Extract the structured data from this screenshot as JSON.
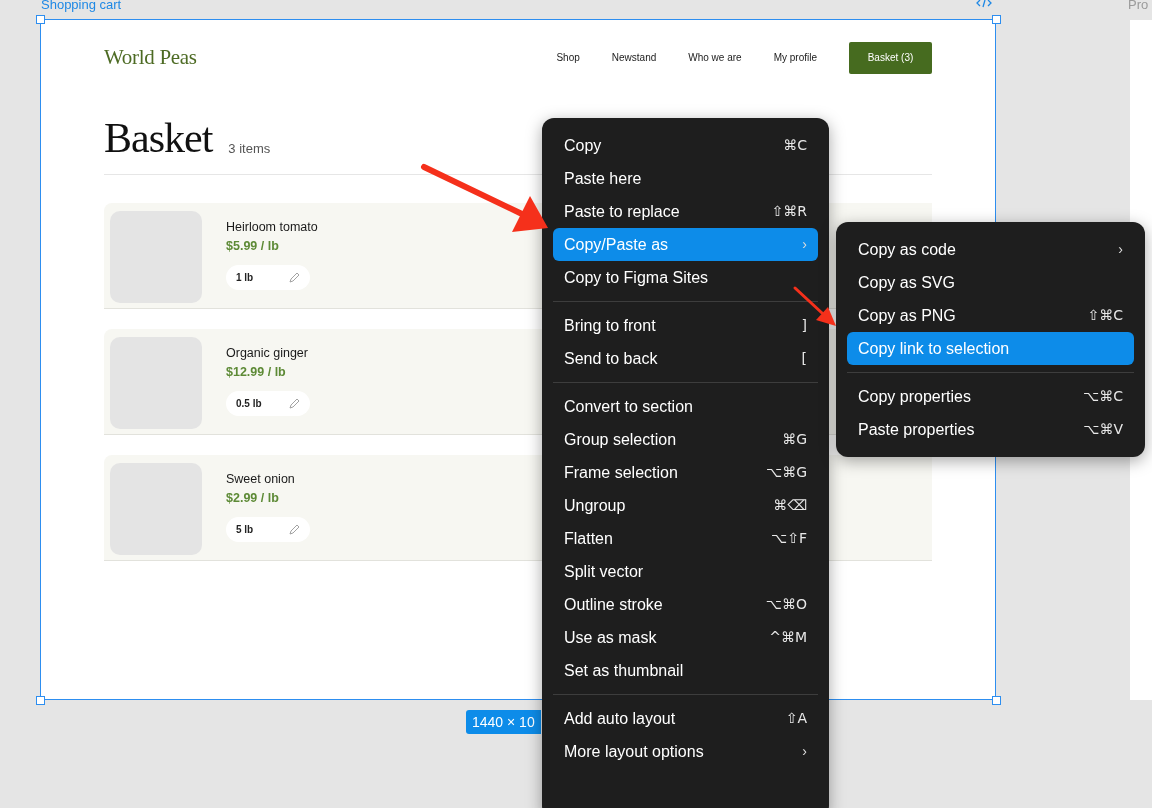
{
  "canvas": {
    "frame_label": "Shopping cart",
    "other_frame_label": "Pro",
    "size_badge": "1440 × 10"
  },
  "page": {
    "logo": "World Peas",
    "nav": [
      "Shop",
      "Newstand",
      "Who we are",
      "My profile"
    ],
    "basket_button": "Basket (3)",
    "heading": "Basket",
    "item_count": "3 items",
    "items": [
      {
        "name": "Heirloom tomato",
        "price": "$5.99 / lb",
        "quantity": "1 lb"
      },
      {
        "name": "Organic ginger",
        "price": "$12.99 / lb",
        "quantity": "0.5 lb"
      },
      {
        "name": "Sweet onion",
        "price": "$2.99 / lb",
        "quantity": "5 lb"
      }
    ]
  },
  "context_menu": [
    {
      "kind": "item",
      "label": "Copy",
      "shortcut": "⌘C",
      "selected": false
    },
    {
      "kind": "item",
      "label": "Paste here",
      "selected": false
    },
    {
      "kind": "item",
      "label": "Paste to replace",
      "shortcut": "⇧⌘R",
      "selected": false
    },
    {
      "kind": "item",
      "label": "Copy/Paste as",
      "arrow": "›",
      "selected": true
    },
    {
      "kind": "item",
      "label": "Copy to Figma Sites",
      "selected": false
    },
    {
      "kind": "separator"
    },
    {
      "kind": "item",
      "label": "Bring to front",
      "shortcut": "]",
      "selected": false
    },
    {
      "kind": "item",
      "label": "Send to back",
      "shortcut": "[",
      "selected": false
    },
    {
      "kind": "separator"
    },
    {
      "kind": "item",
      "label": "Convert to section",
      "selected": false
    },
    {
      "kind": "item",
      "label": "Group selection",
      "shortcut": "⌘G",
      "selected": false
    },
    {
      "kind": "item",
      "label": "Frame selection",
      "shortcut": "⌥⌘G",
      "selected": false
    },
    {
      "kind": "item",
      "label": "Ungroup",
      "shortcut": "⌘⌫",
      "selected": false
    },
    {
      "kind": "item",
      "label": "Flatten",
      "shortcut": "⌥⇧F",
      "selected": false
    },
    {
      "kind": "item",
      "label": "Split vector",
      "selected": false
    },
    {
      "kind": "item",
      "label": "Outline stroke",
      "shortcut": "⌥⌘O",
      "selected": false
    },
    {
      "kind": "item",
      "label": "Use as mask",
      "shortcut": "^⌘M",
      "selected": false
    },
    {
      "kind": "item",
      "label": "Set as thumbnail",
      "selected": false
    },
    {
      "kind": "separator"
    },
    {
      "kind": "item",
      "label": "Add auto layout",
      "shortcut": "⇧A",
      "selected": false
    },
    {
      "kind": "item",
      "label": "More layout options",
      "arrow": "›",
      "selected": false
    }
  ],
  "submenu": [
    {
      "kind": "item",
      "label": "Copy as code",
      "arrow": "›",
      "selected": false
    },
    {
      "kind": "item",
      "label": "Copy as SVG",
      "selected": false
    },
    {
      "kind": "item",
      "label": "Copy as PNG",
      "shortcut": "⇧⌘C",
      "selected": false
    },
    {
      "kind": "item",
      "label": "Copy link to selection",
      "selected": true
    },
    {
      "kind": "separator"
    },
    {
      "kind": "item",
      "label": "Copy properties",
      "shortcut": "⌥⌘C",
      "selected": false
    },
    {
      "kind": "item",
      "label": "Paste properties",
      "shortcut": "⌥⌘V",
      "selected": false
    }
  ]
}
